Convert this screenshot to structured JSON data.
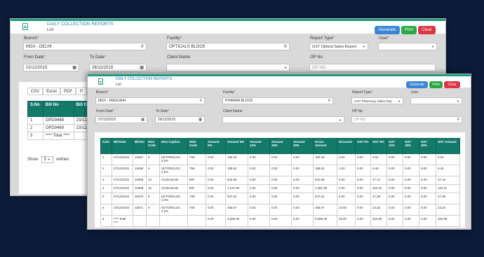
{
  "back": {
    "title": "DAILY COLLECTION REPORTS",
    "subtitle": "List",
    "buttons": {
      "generate": "Generate",
      "print": "Print",
      "clear": "Clear"
    },
    "branch": {
      "label": "Branch",
      "value": "MGX - DELHI"
    },
    "facility": {
      "label": "Facility",
      "value": "OPTICALS BLOCK"
    },
    "report_type": {
      "label": "Report Type",
      "value": "GST Optical Sales Report"
    },
    "user": {
      "label": "User",
      "value": ""
    },
    "from_date": {
      "label": "From Date",
      "value": "02/12/2019"
    },
    "to_date": {
      "label": "To Date",
      "value": "26/12/2019"
    },
    "client_name": {
      "label": "Client Name",
      "value": ""
    },
    "op_no": {
      "label": "OP No",
      "placeholder": "OP NO"
    },
    "export_tabs": [
      "CSV",
      "Excel",
      "PDF",
      "P"
    ],
    "table": {
      "headers": [
        "S.No",
        "Bill No",
        "Bill Da"
      ],
      "rows": [
        [
          "1",
          "OPD9468",
          "23/12/2"
        ],
        [
          "2",
          "OPD9469",
          "23/12/2"
        ],
        [
          "3",
          "**** Total ****",
          ""
        ]
      ]
    },
    "show": {
      "label": "Show",
      "value": "5",
      "suffix": "entries"
    }
  },
  "front": {
    "title": "DAILY COLLECTION REPORTS",
    "subtitle": "List",
    "buttons": {
      "generate": "Generate",
      "print": "Print",
      "clear": "Clear"
    },
    "branch": {
      "label": "Branch",
      "value": "MGX - MADURAI"
    },
    "facility": {
      "label": "Facility",
      "value": "PHARMA BLOCK"
    },
    "report_type": {
      "label": "Report Type",
      "value": "GST Pharmacy Sales Rep"
    },
    "user": {
      "label": "User",
      "value": ""
    },
    "from_date": {
      "label": "From Date",
      "value": "07/12/2019"
    },
    "to_date": {
      "label": "To Date",
      "value": "26/12/2019"
    },
    "client_name": {
      "label": "Client Name",
      "value": ""
    },
    "op_no": {
      "label": "OP No",
      "placeholder": "OP NO"
    },
    "table": {
      "headers": [
        "S.No",
        "Bill Date",
        "Bill No",
        "Item Code",
        "Item Caption",
        "HSN Code",
        "Amount 0%",
        "Amount 5%",
        "Amount 12%",
        "Amount 18%",
        "Amount 28%",
        "Gross Amount",
        "Discount",
        "GST 0%",
        "GST 5%",
        "GST 12%",
        "GST 18%",
        "GST 28%",
        "GST Amount"
      ],
      "rows": [
        [
          "1",
          "07/12/2019",
          "16367",
          "9",
          "KETOROLOC 2.5%",
          "759",
          "0.00",
          "190.48",
          "0.00",
          "0.00",
          "0.00",
          "190.48",
          "0.00",
          "0.00",
          "9.52",
          "0.00",
          "0.00",
          "0.00",
          "9.52"
        ],
        [
          "2",
          "07/12/2019",
          "16368",
          "9",
          "KETOROLOC 2.5%",
          "759",
          "0.00",
          "189.52",
          "0.00",
          "0.00",
          "0.00",
          "189.52",
          "1.00",
          "0.00",
          "9.48",
          "0.00",
          "0.00",
          "0.00",
          "9.45"
        ],
        [
          "3",
          "07/12/2019",
          "16369",
          "10",
          "Clotrimazole",
          "887",
          "0.00",
          "942.86",
          "0.00",
          "0.00",
          "0.00",
          "942.86",
          "5.00",
          "0.00",
          "47.14",
          "0.00",
          "0.00",
          "0.00",
          "47.14"
        ],
        [
          "4",
          "07/12/2019",
          "16369",
          "10",
          "Clotrimazole",
          "887",
          "0.00",
          "1,121.90",
          "0.00",
          "0.00",
          "0.00",
          "2,361.90",
          "0.00",
          "0.00",
          "118.10",
          "0.00",
          "0.00",
          "0.00",
          "118.10"
        ],
        [
          "5",
          "07/12/2019",
          "16370",
          "9",
          "KETOROLOC 2.5%",
          "759",
          "0.00",
          "947.62",
          "0.00",
          "0.00",
          "0.00",
          "947.62",
          "5.00",
          "0.00",
          "47.38",
          "0.00",
          "0.00",
          "0.00",
          "47.38"
        ],
        [
          "6",
          "10/12/2019",
          "16371",
          "9",
          "KETOROLOC 2.5%",
          "759",
          "0.00",
          "466.67",
          "0.00",
          "0.00",
          "0.00",
          "466.67",
          "10.00",
          "0.00",
          "23.33",
          "0.00",
          "0.00",
          "0.00",
          "23.33"
        ],
        [
          "6",
          "**** Total ****",
          "",
          "",
          "",
          "",
          "0.00",
          "3,659.05",
          "0.00",
          "0.00",
          "0.00",
          "5,099.05",
          "26.00",
          "0.00",
          "254.95",
          "0.00",
          "0.00",
          "0.00",
          "254.95"
        ]
      ]
    }
  }
}
